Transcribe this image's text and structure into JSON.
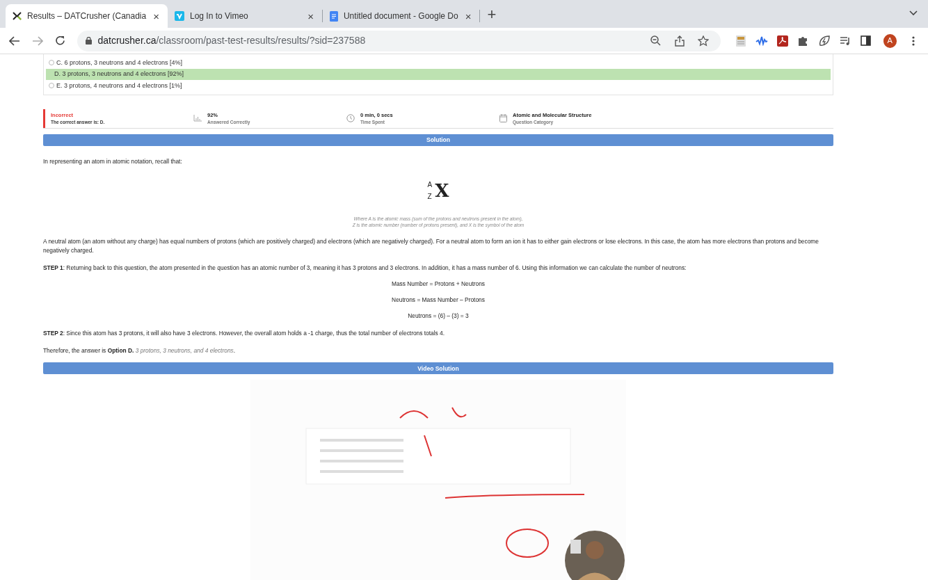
{
  "browser": {
    "tabs": [
      {
        "title": "Results – DATCrusher (Canadia",
        "close": "×",
        "selected": true
      },
      {
        "title": "Log In to Vimeo",
        "close": "×",
        "selected": false
      },
      {
        "title": "Untitled document - Google Do",
        "close": "×",
        "selected": false
      }
    ],
    "new_tab": "+",
    "url": {
      "host": "datcrusher.ca",
      "path": "/classroom/past-test-results/results/?sid=237588"
    },
    "profile": "A"
  },
  "answers": [
    {
      "label": "C. 6 protons, 3 neutrons and 4 electrons [4%]",
      "selected": false
    },
    {
      "label": "D. 3 protons, 3 neutrons and 4 electrons [92%]",
      "selected": true
    },
    {
      "label": "E. 3 protons, 4 neutrons and 4 electrons [1%]",
      "selected": false
    }
  ],
  "result": {
    "status": "Incorrect",
    "note": "The correct answer is: D.",
    "stats": [
      {
        "kind": "chart",
        "value": "92%",
        "label": "Answered Correctly"
      },
      {
        "kind": "clock",
        "value": "0 min, 0 secs",
        "label": "Time Spent"
      },
      {
        "kind": "calendar",
        "value": "Atomic and Molecular Structure",
        "label": "Question Category"
      }
    ]
  },
  "solution": {
    "heading": "Solution",
    "intro": "In representing an atom in atomic notation, recall that:",
    "notation": {
      "mass": "A",
      "number": "Z",
      "symbol": "X"
    },
    "caption": [
      "Where A is the atomic mass (sum of the protons and neutrons present in the atom),",
      "Z is the atomic number (number of protons present), and X is the symbol of the atom"
    ],
    "blocks": [
      {
        "kind": "text",
        "text": "A neutral atom (an atom without any charge) has equal numbers of protons (which are positively charged) and electrons (which are negatively charged). For a neutral atom to form an ion it has to either gain electrons or lose electrons. In this case, the atom has more electrons than protons and become negatively charged."
      },
      {
        "kind": "text",
        "text": "**STEP 1**: Returning back to this question, the atom presented in the question has an atomic number of 3, meaning it has 3 protons and 3 electrons. In addition, it has a mass number of 6. Using this information we can calculate the number of neutrons:"
      },
      {
        "kind": "equation",
        "text": "Mass Number = Protons + Neutrons"
      },
      {
        "kind": "equation",
        "text": "Neutrons = Mass Number – Protons"
      },
      {
        "kind": "equation",
        "text": "Neutrons = (6) – (3) = 3"
      },
      {
        "kind": "text",
        "text": "**STEP 2**: Since this atom has 3 protons, it will also have 3 electrons. However, the overall atom holds a -1 charge, thus the total number of electrons totals 4."
      },
      {
        "kind": "text",
        "text": "Therefore, the answer is **Option D.** *3 protons, 3 neutrons, and 4 electrons*."
      }
    ]
  },
  "video": {
    "heading": "Video Solution",
    "kind": "picture"
  }
}
